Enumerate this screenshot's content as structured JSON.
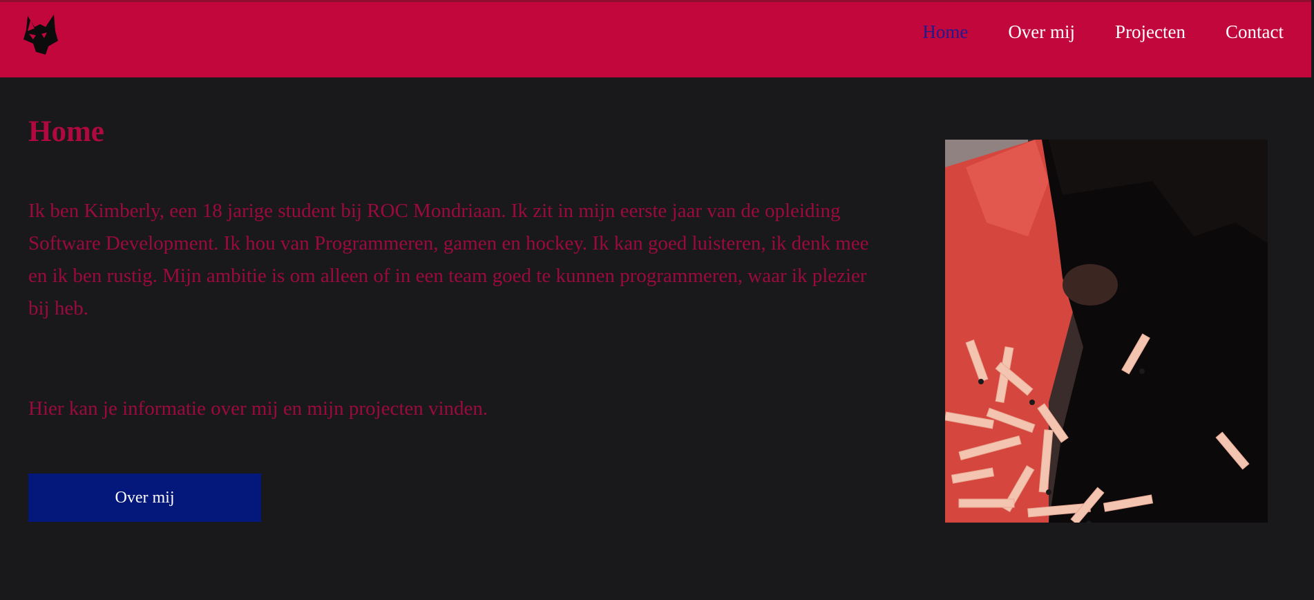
{
  "nav": {
    "items": [
      {
        "label": "Home",
        "active": true
      },
      {
        "label": "Over mij",
        "active": false
      },
      {
        "label": "Projecten",
        "active": false
      },
      {
        "label": "Contact",
        "active": false
      }
    ]
  },
  "logo": {
    "icon": "wolf-head-icon"
  },
  "main": {
    "title": "Home",
    "intro": "Ik ben Kimberly, een 18 jarige student bij ROC Mondriaan. Ik zit in mijn eerste jaar van de opleiding Software Development. Ik hou van Programmeren, gamen en hockey. Ik kan goed luisteren, ik denk mee en ik ben rustig. Mijn ambitie is om alleen of in een team goed te kunnen programmeren, waar ik plezier bij heb.",
    "info": "Hier kan je informatie over mij en mijn projecten vinden.",
    "button_label": "Over mij"
  },
  "colors": {
    "header": "#c2073c",
    "background": "#19191b",
    "text": "#9b0a3e",
    "active_nav": "#201a8c",
    "button": "#04187b"
  }
}
